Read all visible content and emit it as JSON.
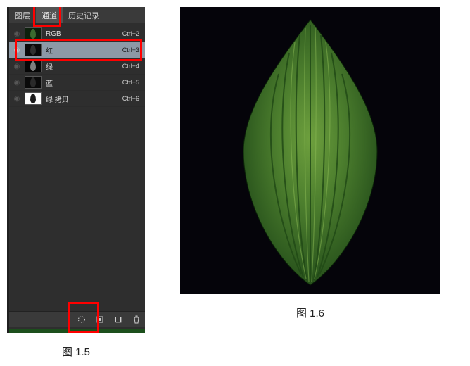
{
  "tabs": {
    "layers": "图层",
    "channels": "通道",
    "history": "历史记录"
  },
  "channels": [
    {
      "name": "RGB",
      "shortcut": "Ctrl+2",
      "visible": false,
      "thumb_bg": "#0d200d",
      "leaf_tint": "#3a6a2f"
    },
    {
      "name": "红",
      "shortcut": "Ctrl+3",
      "visible": true,
      "thumb_bg": "#0a0a0a",
      "leaf_tint": "#303030",
      "selected": true
    },
    {
      "name": "绿",
      "shortcut": "Ctrl+4",
      "visible": false,
      "thumb_bg": "#060606",
      "leaf_tint": "#7e7e7e"
    },
    {
      "name": "蓝",
      "shortcut": "Ctrl+5",
      "visible": false,
      "thumb_bg": "#0a0a0a",
      "leaf_tint": "#2a2a2a"
    },
    {
      "name": "绿 拷贝",
      "shortcut": "Ctrl+6",
      "visible": false,
      "thumb_bg": "#ffffff",
      "leaf_tint": "#1c1c1c"
    }
  ],
  "footer_icons": {
    "load_selection": "load-selection-icon",
    "save_selection": "save-selection-icon",
    "new_channel": "new-channel-icon",
    "delete": "trash-icon"
  },
  "captions": {
    "left": "图 1.5",
    "right": "图 1.6"
  }
}
